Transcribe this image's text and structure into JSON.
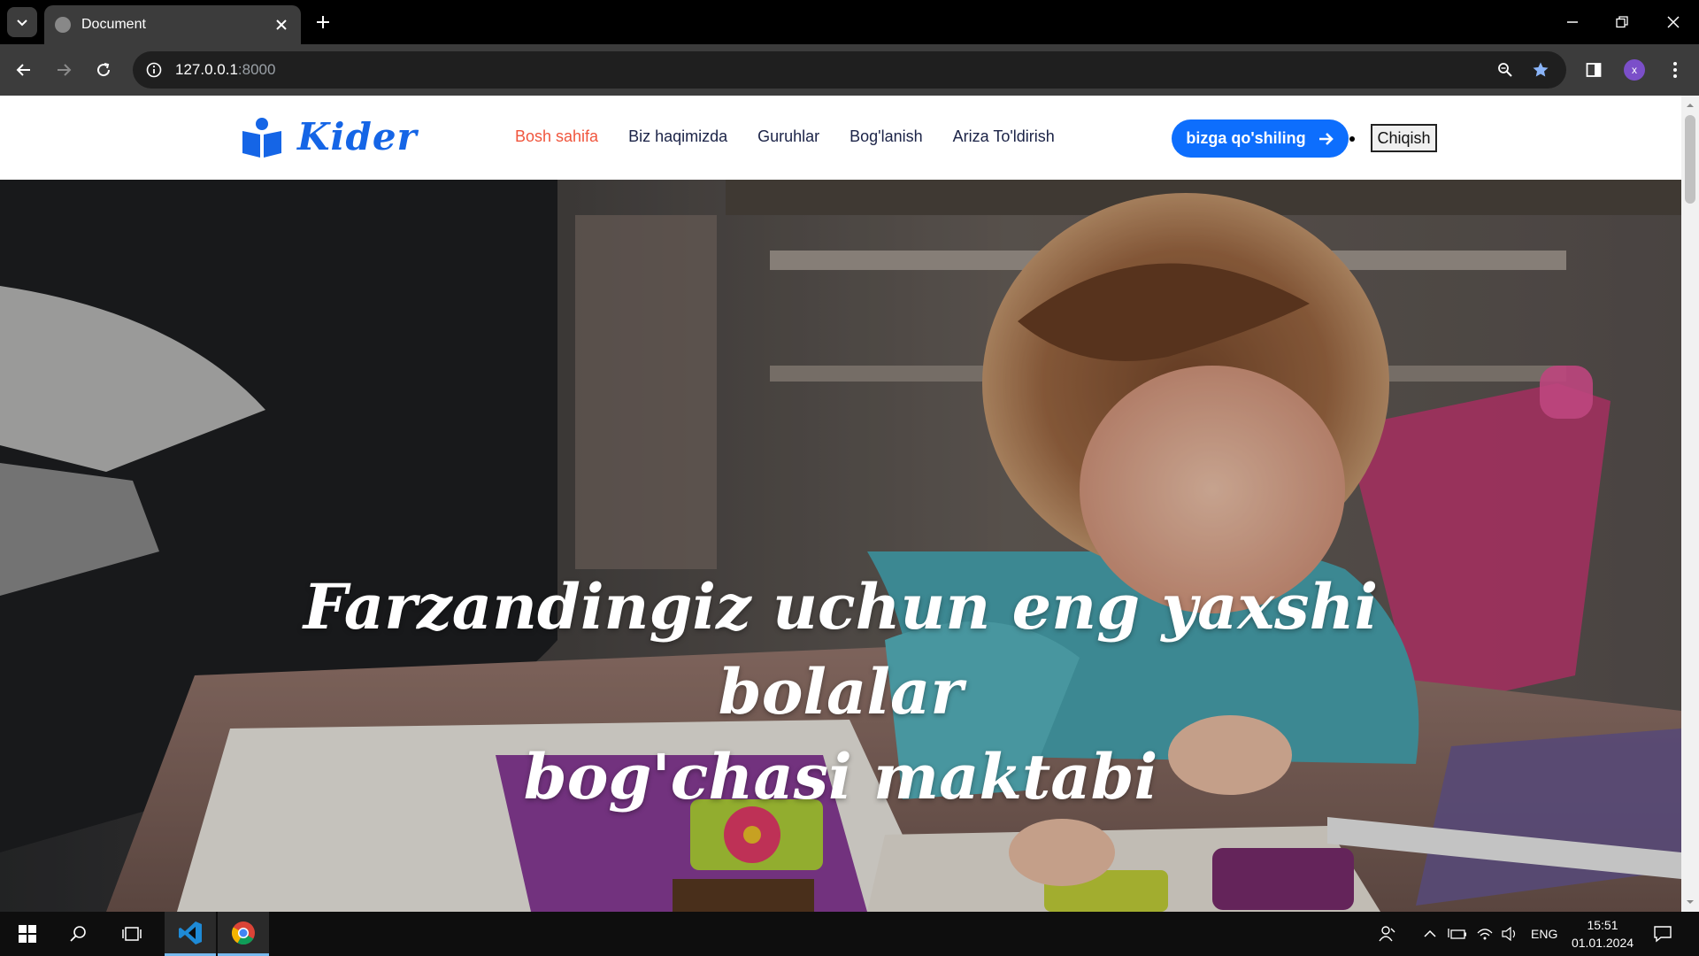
{
  "browser": {
    "tab_title": "Document",
    "url_host": "127.0.0.1",
    "url_port": ":8000",
    "profile_initial": "x"
  },
  "site": {
    "logo_text": "Kider",
    "nav": [
      {
        "label": "Bosh sahifa",
        "active": true
      },
      {
        "label": "Biz haqimizda",
        "active": false
      },
      {
        "label": "Guruhlar",
        "active": false
      },
      {
        "label": "Bog'lanish",
        "active": false
      },
      {
        "label": "Ariza To'ldirish",
        "active": false
      }
    ],
    "join_button": "bizga qo'shiling",
    "logout_button": "Chiqish",
    "hero_line1": "Farzandingiz uchun eng yaxshi bolalar",
    "hero_line2": "bog'chasi maktabi"
  },
  "taskbar": {
    "language": "ENG",
    "time": "15:51",
    "date": "01.01.2024"
  },
  "colors": {
    "brand_blue": "#1565e6",
    "active_nav": "#f0553d",
    "button_blue": "#0d6efd"
  }
}
